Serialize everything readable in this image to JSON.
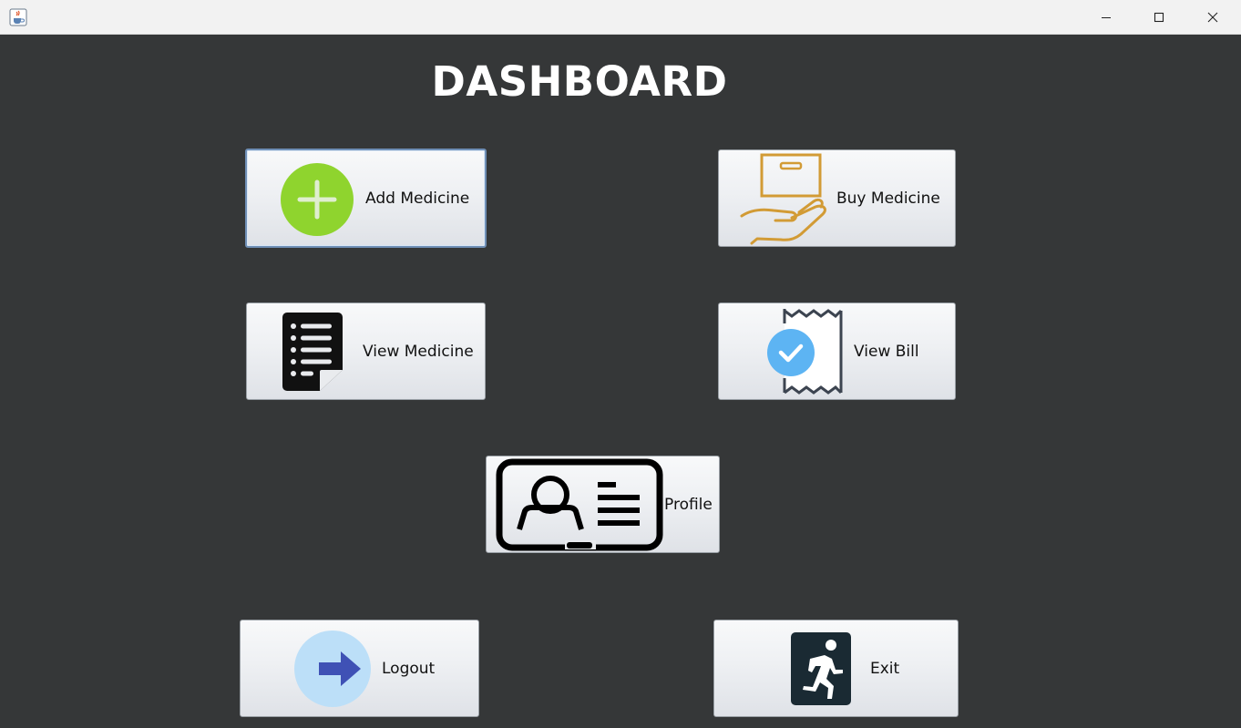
{
  "window": {
    "app_icon": "java-cup-icon",
    "controls": [
      "minimize-icon",
      "maximize-icon",
      "close-icon"
    ]
  },
  "dashboard": {
    "title": "DASHBOARD",
    "buttons": {
      "add_medicine": {
        "label": "Add Medicine",
        "icon": "plus-circle-icon",
        "color": "#8fd42e"
      },
      "buy_medicine": {
        "label": "Buy Medicine",
        "icon": "hand-box-icon",
        "color": "#d29b35"
      },
      "view_medicine": {
        "label": "View Medicine",
        "icon": "document-list-icon",
        "color": "#111111"
      },
      "view_bill": {
        "label": "View Bill",
        "icon": "receipt-check-icon",
        "color": "#5db4f3"
      },
      "profile": {
        "label": "Profile",
        "icon": "id-card-icon",
        "color": "#111111"
      },
      "logout": {
        "label": "Logout",
        "icon": "arrow-right-icon",
        "color": "#3f51b5"
      },
      "exit": {
        "label": "Exit",
        "icon": "running-exit-icon",
        "color": "#1a2a33"
      }
    }
  },
  "colors": {
    "background": "#353738",
    "title_text": "#ffffff",
    "titlebar": "#f2f2f2"
  }
}
